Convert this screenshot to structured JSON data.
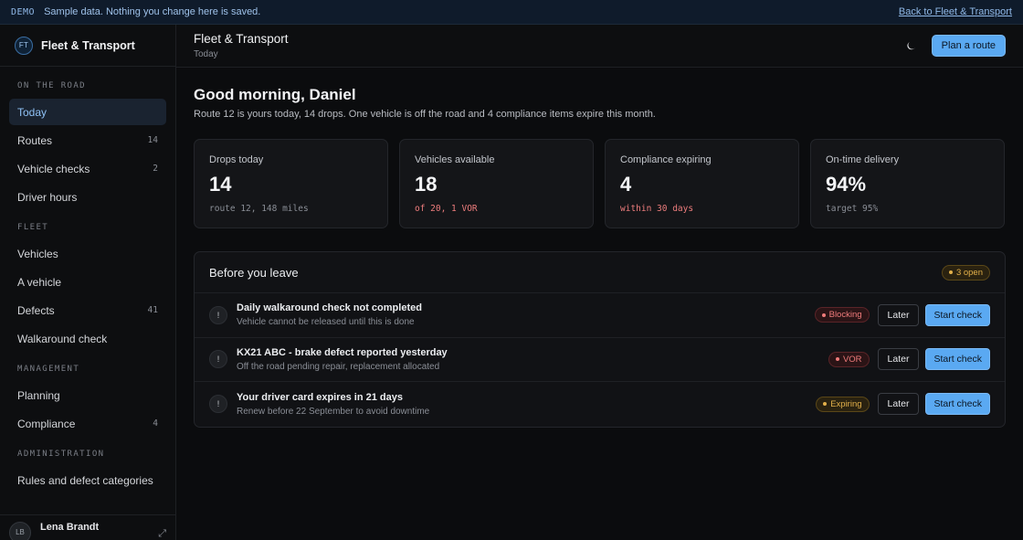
{
  "demo": {
    "tag": "DEMO",
    "message": "Sample data. Nothing you change here is saved.",
    "back_link": "Back to Fleet & Transport"
  },
  "brand": {
    "initials": "FT",
    "name": "Fleet & Transport"
  },
  "sidebar": {
    "sections": [
      {
        "title": "ON THE ROAD",
        "items": [
          {
            "label": "Today",
            "count": "",
            "active": true
          },
          {
            "label": "Routes",
            "count": "14"
          },
          {
            "label": "Vehicle checks",
            "count": "2"
          },
          {
            "label": "Driver hours",
            "count": ""
          }
        ]
      },
      {
        "title": "FLEET",
        "items": [
          {
            "label": "Vehicles",
            "count": ""
          },
          {
            "label": "A vehicle",
            "count": ""
          },
          {
            "label": "Defects",
            "count": "41"
          },
          {
            "label": "Walkaround check",
            "count": ""
          }
        ]
      },
      {
        "title": "MANAGEMENT",
        "items": [
          {
            "label": "Planning",
            "count": ""
          },
          {
            "label": "Compliance",
            "count": "4"
          }
        ]
      },
      {
        "title": "ADMINISTRATION",
        "items": [
          {
            "label": "Rules and defect categories",
            "count": ""
          }
        ]
      }
    ],
    "user": {
      "initials": "LB",
      "name": "Lena Brandt"
    }
  },
  "header": {
    "title": "Fleet & Transport",
    "subtitle": "Today",
    "cta": "Plan a route"
  },
  "main": {
    "greeting": "Good morning, Daniel",
    "summary": "Route 12 is yours today, 14 drops. One vehicle is off the road and 4 compliance items expire this month.",
    "stats": [
      {
        "label": "Drops today",
        "value": "14",
        "note": "route 12, 148 miles",
        "tone": "muted"
      },
      {
        "label": "Vehicles available",
        "value": "18",
        "note": "of 20, 1 VOR",
        "tone": "warn"
      },
      {
        "label": "Compliance expiring",
        "value": "4",
        "note": "within 30 days",
        "tone": "warn"
      },
      {
        "label": "On-time delivery",
        "value": "94%",
        "note": "target 95%",
        "tone": "muted"
      }
    ],
    "panel": {
      "title": "Before you leave",
      "badge": "3 open",
      "tasks": [
        {
          "title": "Daily walkaround check not completed",
          "sub": "Vehicle cannot be released until this is done",
          "badge": "Blocking",
          "tone": "red"
        },
        {
          "title": "KX21 ABC - brake defect reported yesterday",
          "sub": "Off the road pending repair, replacement allocated",
          "badge": "VOR",
          "tone": "red"
        },
        {
          "title": "Your driver card expires in 21 days",
          "sub": "Renew before 22 September to avoid downtime",
          "badge": "Expiring",
          "tone": "amber"
        }
      ],
      "later_label": "Later",
      "start_label": "Start check"
    }
  },
  "colors": {
    "accent": "#5aa9f2",
    "danger": "#ef7b7b",
    "warning": "#e2b04a"
  }
}
